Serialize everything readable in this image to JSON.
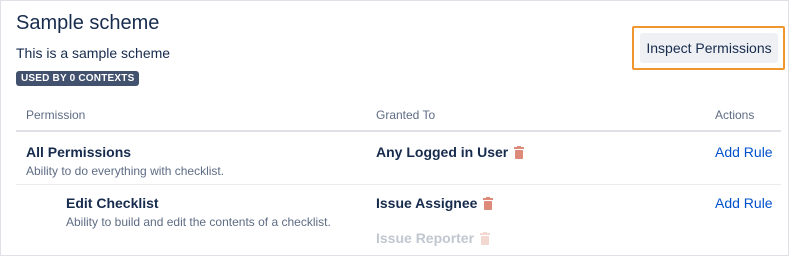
{
  "scheme": {
    "title": "Sample scheme",
    "description": "This is a sample scheme",
    "usage_badge": "USED BY 0 CONTEXTS",
    "inspect_button": "Inspect Permissions"
  },
  "table": {
    "headers": {
      "permission": "Permission",
      "granted_to": "Granted To",
      "actions": "Actions"
    },
    "rows": [
      {
        "name": "All Permissions",
        "description": "Ability to do everything with checklist.",
        "granted": [
          "Any Logged in User"
        ],
        "action": "Add Rule"
      },
      {
        "name": "Edit Checklist",
        "description": "Ability to build and edit the contents of a checklist.",
        "granted": [
          "Issue Assignee",
          "Issue Reporter"
        ],
        "action": "Add Rule"
      }
    ]
  },
  "icons": {
    "delete": "trash-icon"
  },
  "colors": {
    "link": "#0052cc",
    "highlight": "#f0962e",
    "trash": "#de8a7a",
    "badge": "#42526e"
  }
}
